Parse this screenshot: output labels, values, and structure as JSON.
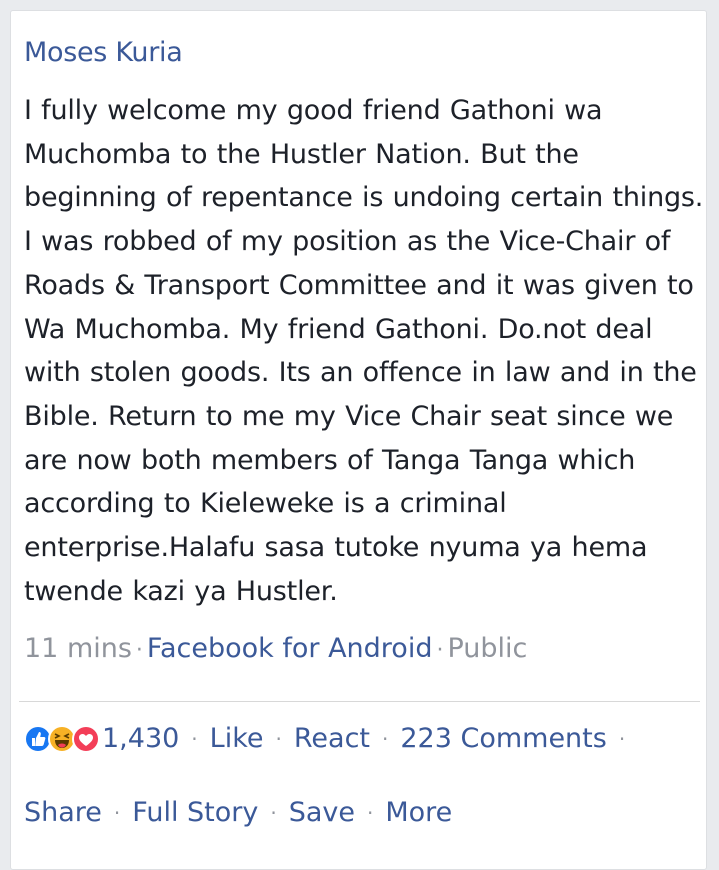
{
  "post": {
    "author": "Moses Kuria",
    "text": "I fully welcome my good friend Gathoni wa Muchomba to the Hustler Nation. But the beginning of repentance is undoing certain things. I was robbed of my position as the Vice-Chair of Roads & Transport Committee and it was given to Wa Muchomba. My friend Gathoni. Do.not deal with stolen goods. Its an offence in law and in the Bible. Return to me my Vice Chair seat since we are now both members of Tanga Tanga which according to Kieleweke is a criminal enterprise.Halafu sasa tutoke nyuma ya hema twende kazi ya Hustler.",
    "time": "11 mins",
    "source": "Facebook for Android",
    "privacy": "Public"
  },
  "reactions": {
    "icons": [
      "like-icon",
      "haha-icon",
      "love-icon"
    ],
    "count": "1,430"
  },
  "actions": {
    "like": "Like",
    "react": "React",
    "comments": "223 Comments",
    "share": "Share",
    "full_story": "Full Story",
    "save": "Save",
    "more": "More"
  },
  "colors": {
    "link": "#3b5998",
    "meta": "#90949c",
    "text": "#1d2129",
    "like_blue": "#1877f2",
    "haha_yellow": "#f7b125",
    "love_red": "#f33e58"
  }
}
